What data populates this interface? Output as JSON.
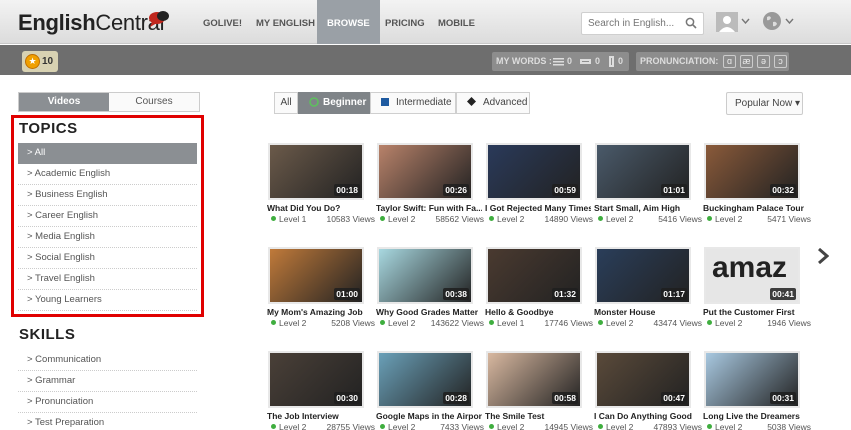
{
  "brand": {
    "name_bold": "English",
    "name_rest": "Central"
  },
  "nav": [
    "GOLIVE!",
    "MY ENGLISH",
    "BROWSE",
    "PRICING",
    "MOBILE"
  ],
  "search": {
    "placeholder": "Search in English..."
  },
  "points": "10",
  "mywords": {
    "label": "MY WORDS :",
    "counts": [
      "0",
      "0",
      "0"
    ]
  },
  "pronunciation": {
    "label": "PRONUNCIATION:",
    "symbols": [
      "ɑ",
      "æ",
      "ə",
      "ɔ"
    ]
  },
  "sidebar": {
    "tabs": [
      "Videos",
      "Courses"
    ],
    "topics_title": "TOPICS",
    "topics": [
      "> All",
      "> Academic English",
      "> Business English",
      "> Career English",
      "> Media English",
      "> Social English",
      "> Travel English",
      "> Young Learners"
    ],
    "skills_title": "SKILLS",
    "skills": [
      "> Communication",
      "> Grammar",
      "> Pronunciation",
      "> Test Preparation"
    ]
  },
  "filters": {
    "all": "All",
    "beginner": "Beginner",
    "intermediate": "Intermediate",
    "advanced": "Advanced",
    "sort": "Popular Now"
  },
  "videos": [
    {
      "title": "What Did You Do?",
      "level": "Level 1",
      "views": "10583 Views",
      "duration": "00:18",
      "color": "#6b5a4a"
    },
    {
      "title": "Taylor Swift: Fun with Fa...",
      "level": "Level 2",
      "views": "58562 Views",
      "duration": "00:26",
      "color": "#b8826a"
    },
    {
      "title": "I Got Rejected Many Times",
      "level": "Level 2",
      "views": "14890 Views",
      "duration": "00:59",
      "color": "#2a3a5a"
    },
    {
      "title": "Start Small, Aim High",
      "level": "Level 2",
      "views": "5416 Views",
      "duration": "01:01",
      "color": "#4a5a6a"
    },
    {
      "title": "Buckingham Palace Tour",
      "level": "Level 2",
      "views": "5471 Views",
      "duration": "00:32",
      "color": "#8a5a3a"
    },
    {
      "title": "My Mom's Amazing Job",
      "level": "Level 2",
      "views": "5208 Views",
      "duration": "01:00",
      "color": "#c07a3a"
    },
    {
      "title": "Why Good Grades Matter",
      "level": "Level 2",
      "views": "143622 Views",
      "duration": "00:38",
      "color": "#a8d8e0"
    },
    {
      "title": "Hello & Goodbye",
      "level": "Level 1",
      "views": "17746 Views",
      "duration": "01:32",
      "color": "#4a3a30"
    },
    {
      "title": "Monster House",
      "level": "Level 2",
      "views": "43474 Views",
      "duration": "01:17",
      "color": "#2a3e5a"
    },
    {
      "title": "Put the Customer First",
      "level": "Level 2",
      "views": "1946 Views",
      "duration": "00:41",
      "color": "#d8d8d8"
    },
    {
      "title": "The Job Interview",
      "level": "Level 2",
      "views": "28755 Views",
      "duration": "00:30",
      "color": "#4a4038"
    },
    {
      "title": "Google Maps in the Airport",
      "level": "Level 2",
      "views": "7433 Views",
      "duration": "00:28",
      "color": "#6aa0b8"
    },
    {
      "title": "The Smile Test",
      "level": "Level 2",
      "views": "14945 Views",
      "duration": "00:58",
      "color": "#d8b8a0"
    },
    {
      "title": "I Can Do Anything Good",
      "level": "Level 2",
      "views": "47893 Views",
      "duration": "00:47",
      "color": "#5a4a3a"
    },
    {
      "title": "Long Live the Dreamers",
      "level": "Level 2",
      "views": "5038 Views",
      "duration": "00:31",
      "color": "#a8c8e0"
    }
  ],
  "thumb_text": "amaz"
}
